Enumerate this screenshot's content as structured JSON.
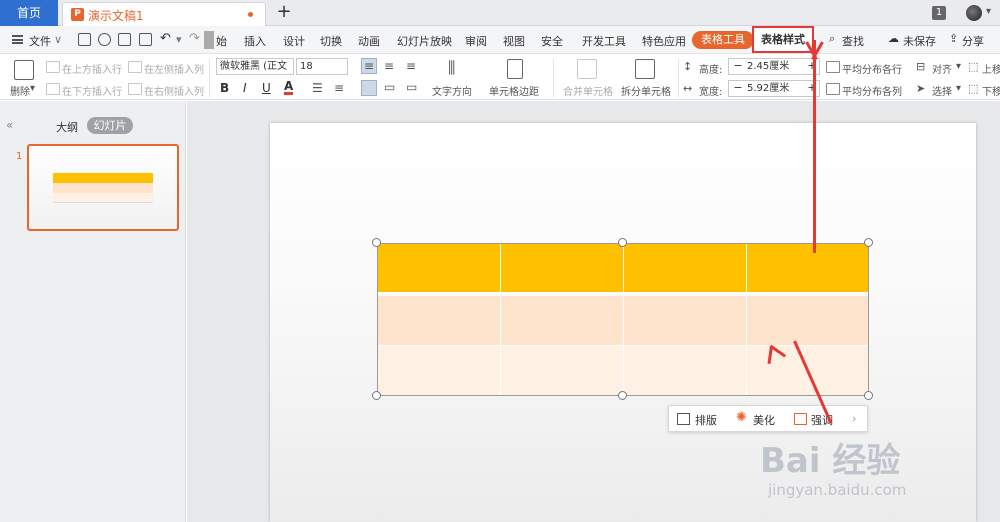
{
  "tabs": {
    "home": "首页",
    "doc_title": "演示文稿1",
    "badge": "1"
  },
  "menu": {
    "file": "文件",
    "items": [
      "始",
      "插入",
      "设计",
      "切换",
      "动画",
      "幻灯片放映",
      "审阅",
      "视图",
      "安全",
      "开发工具",
      "特色应用"
    ],
    "table_tools": "表格工具",
    "table_style": "表格样式",
    "find": "查找",
    "unsaved": "未保存",
    "share": "分享"
  },
  "ribbon": {
    "delete": "删除",
    "insert_above": "在上方插入行",
    "insert_below": "在下方插入行",
    "insert_left": "在左侧插入列",
    "insert_right": "在右侧插入列",
    "font_name": "微软雅黑 (正文",
    "font_size": "18",
    "bold": "B",
    "italic": "I",
    "underline": "U",
    "font_color": "A",
    "text_direction": "文字方向",
    "cell_margin": "单元格边距",
    "merge_cells": "合并单元格",
    "split_cells": "拆分单元格",
    "height_label": "高度:",
    "height_value": "2.45厘米",
    "width_label": "宽度:",
    "width_value": "5.92厘米",
    "distribute_rows": "平均分布各行",
    "distribute_cols": "平均分布各列",
    "align": "对齐",
    "select": "选择",
    "move_up": "上移",
    "move_down": "下移"
  },
  "panel": {
    "outline": "大纲",
    "slides": "幻灯片",
    "slide_number": "1"
  },
  "float_toolbar": {
    "layout": "排版",
    "beautify": "美化",
    "emphasize": "强调"
  },
  "table": {
    "columns": 4,
    "rows": 3,
    "row_colors": [
      "#ffc000",
      "#fde3cb",
      "#fff0e4"
    ]
  },
  "watermark": {
    "logo": "Bai 经验",
    "url": "jingyan.baidu.com"
  },
  "colors": {
    "accent": "#e8662e",
    "home_tab": "#2f6fd0",
    "annotation": "#e53935"
  }
}
